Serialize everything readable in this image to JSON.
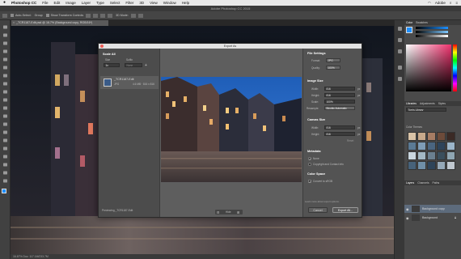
{
  "menubar": {
    "app": "Photoshop CC",
    "items": [
      "File",
      "Edit",
      "Image",
      "Layer",
      "Type",
      "Select",
      "Filter",
      "3D",
      "View",
      "Window",
      "Help"
    ],
    "right_label": "Adobe"
  },
  "app_title": "Adobe Photoshop CC 2015",
  "options_bar": {
    "auto_select": "Auto-Select:",
    "group": "Group",
    "transform": "Show Transform Controls",
    "mode_3d": "3D Mode:"
  },
  "doc_tab": "_TCR1187-Edit.psd @ 16.7% (Background copy, RGB/16*)",
  "status_bar": "16.67%   Doc: 117.1M/233.7M",
  "dialog": {
    "title": "Export As",
    "scale_all": {
      "heading": "Scale All",
      "size_label": "Size",
      "suffix_label": "Suffix",
      "size_value": "1x",
      "suffix_value": "None"
    },
    "asset": {
      "name": "_TCR1187-Edit",
      "format": "JPG",
      "info": "4.6 MB · 816 x 816"
    },
    "zoom": "Hide",
    "file_settings": {
      "heading": "File Settings",
      "format_label": "Format:",
      "format_value": "JPG",
      "quality_label": "Quality:",
      "quality_value": "100%"
    },
    "image_size": {
      "heading": "Image Size",
      "width_label": "Width:",
      "width_value": "816",
      "height_label": "Height:",
      "height_value": "816",
      "scale_label": "Scale:",
      "scale_value": "100%",
      "resample_label": "Resample:",
      "resample_value": "Bicubic Automatic",
      "unit": "px"
    },
    "canvas_size": {
      "heading": "Canvas Size",
      "width_label": "Width:",
      "width_value": "816",
      "height_label": "Height:",
      "height_value": "816",
      "reset": "Reset",
      "unit": "px"
    },
    "metadata": {
      "heading": "Metadata",
      "none": "None",
      "copyright": "Copyright and Contact Info"
    },
    "color_space": {
      "heading": "Color Space",
      "convert": "Convert to sRGB"
    },
    "learn_more": "Learn more about export options.",
    "preview_label": "Previewing _TCR1187-Edit",
    "cancel": "Cancel",
    "export": "Export All..."
  },
  "panels": {
    "color_tabs": [
      "Color",
      "Swatches"
    ],
    "library_tabs": [
      "Libraries",
      "Adjustments",
      "Styles"
    ],
    "library_select": "Tom's Library",
    "library_section": "Color Themes",
    "layers_tabs": [
      "Layers",
      "Channels",
      "Paths"
    ],
    "layers": [
      {
        "name": "Background copy"
      },
      {
        "name": "Background"
      }
    ]
  },
  "colors": {
    "accent": "#e0e0e0",
    "primary_fg": "#1e90ff",
    "swatches": [
      "#d9c3a7",
      "#c7a98b",
      "#a67c63",
      "#6d4b3a",
      "#3b2a25",
      "#5b7a95",
      "#7e9cb7",
      "#4a6580",
      "#2d435a",
      "#9bb5c9",
      "#c9d6df",
      "#a3b8c4",
      "#6a7f8f",
      "#3a4e5c",
      "#8fa6b2",
      "#47627a",
      "#6f8fa8",
      "#2e4459",
      "#95a8b7",
      "#c0c8cf"
    ]
  }
}
